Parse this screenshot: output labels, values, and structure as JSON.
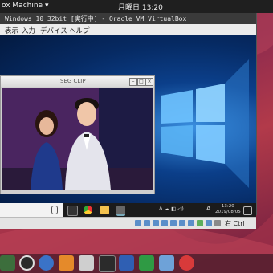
{
  "ubuntu_topbar": {
    "app_menu": "ox Machine ▾",
    "clock": "月曜日 13:20"
  },
  "vbox": {
    "title": "Windows 10 32bit [実行中] - Oracle VM VirtualBox",
    "menu": [
      "表示",
      "入力",
      "デバイス",
      "ヘルプ"
    ],
    "host_key": "右 Ctrl"
  },
  "segclip": {
    "title": "SEG CLIP"
  },
  "win_taskbar": {
    "tray_text": "A",
    "time": "13:20",
    "date": "2019/08/05"
  },
  "colors": {
    "ubuntu_bar": "#1f1f1f",
    "windows_blue": "#0b3f8a",
    "taskbar": "#1b1b1b",
    "ubuntu_wallpaper": "#8e2b4e"
  },
  "dock_icons": [
    "files-icon",
    "rhythmbox-icon",
    "help-icon",
    "software-store-icon",
    "camera-icon",
    "terminal-icon",
    "libreoffice-writer-icon",
    "libreoffice-calc-icon",
    "virtualbox-icon",
    "record-icon"
  ]
}
